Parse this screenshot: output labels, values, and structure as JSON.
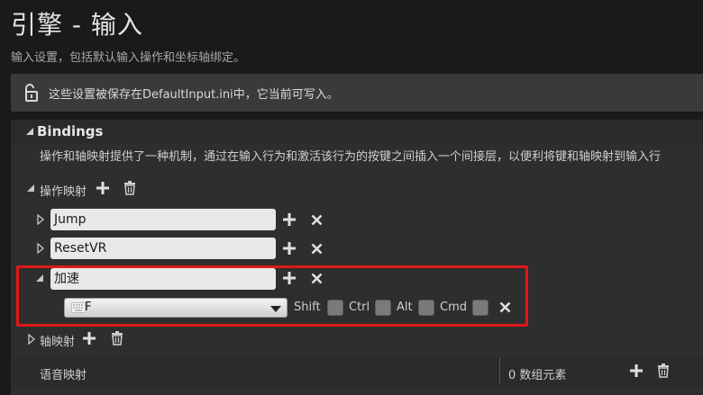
{
  "page": {
    "title": "引擎 - 输入",
    "subtitle": "输入设置，包括默认输入操作和坐标轴绑定。"
  },
  "notice": {
    "message": "这些设置被保存在DefaultInput.ini中，它当前可写入。",
    "icon": "lock-open-icon"
  },
  "bindings": {
    "header": "Bindings",
    "description": "操作和轴映射提供了一种机制，通过在输入行为和激活该行为的按键之间插入一个间接层，以便利将键和轴映射到输入行",
    "action_mappings": {
      "label": "操作映射",
      "items": [
        {
          "name": "Jump",
          "expanded": false
        },
        {
          "name": "ResetVR",
          "expanded": false
        },
        {
          "name": "加速",
          "expanded": true
        }
      ],
      "key_binding": {
        "key": "F",
        "modifiers": [
          {
            "label": "Shift",
            "checked": false
          },
          {
            "label": "Ctrl",
            "checked": false
          },
          {
            "label": "Alt",
            "checked": false
          },
          {
            "label": "Cmd",
            "checked": false
          }
        ]
      }
    },
    "axis_mappings": {
      "label": "轴映射"
    },
    "voice_mapping": {
      "label": "语音映射",
      "value": "0 数组元素"
    }
  },
  "colors": {
    "highlight": "#e01818",
    "background": "#1a1a1a",
    "panel": "#2e2e2e"
  }
}
